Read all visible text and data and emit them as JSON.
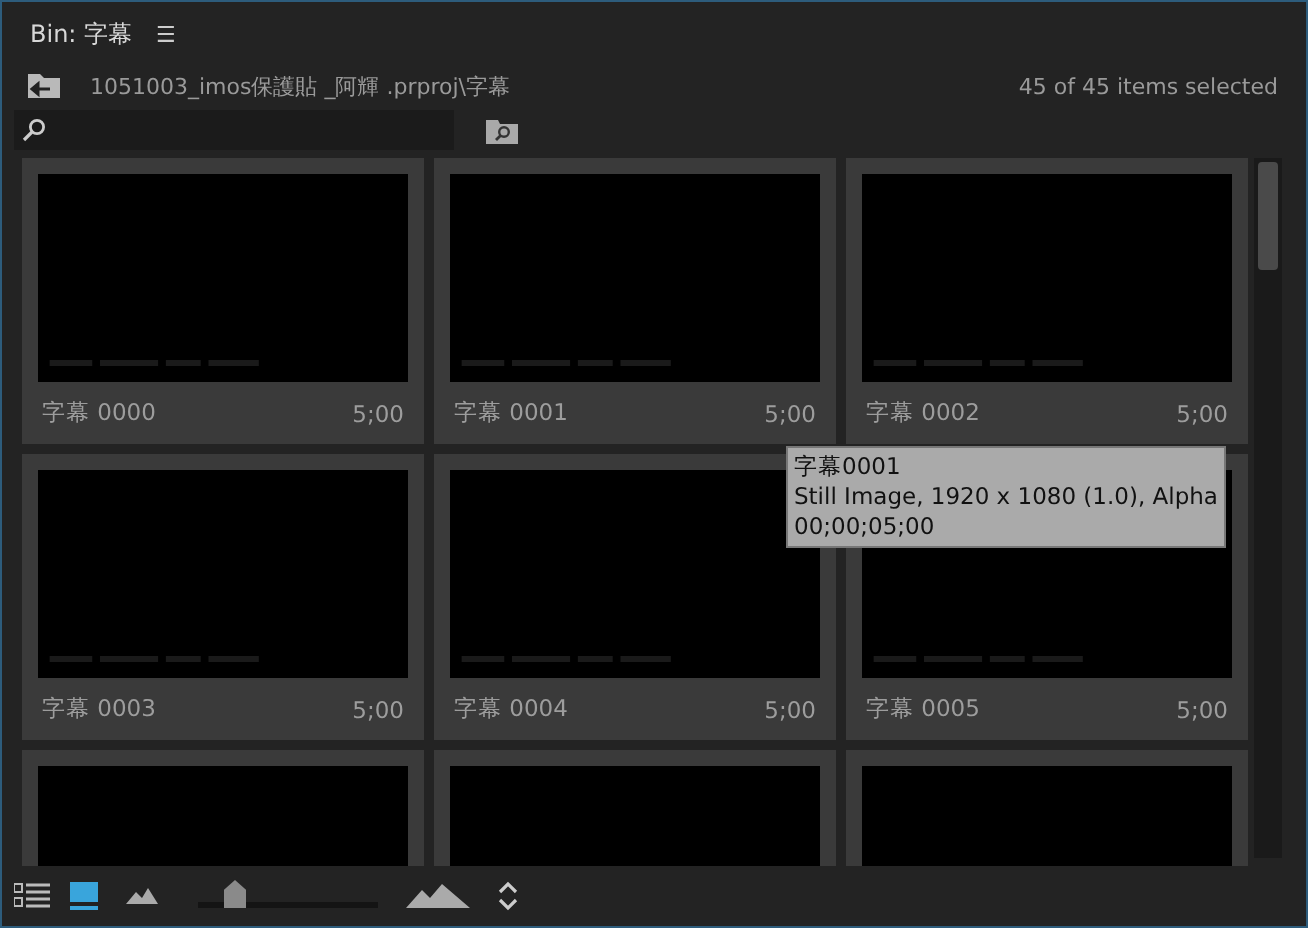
{
  "panel": {
    "title": "Bin: 字幕",
    "menu_glyph": "☰"
  },
  "path": "1051003_imos保護貼 _阿輝 .prproj\\字幕",
  "selection_count": "45 of 45 items selected",
  "items": [
    {
      "name": "字幕 0000",
      "duration": "5;00",
      "selected": true
    },
    {
      "name": "字幕 0001",
      "duration": "5;00",
      "selected": true
    },
    {
      "name": "字幕 0002",
      "duration": "5;00",
      "selected": true
    },
    {
      "name": "字幕 0003",
      "duration": "5;00",
      "selected": true
    },
    {
      "name": "字幕 0004",
      "duration": "5;00",
      "selected": true
    },
    {
      "name": "字幕 0005",
      "duration": "5;00",
      "selected": true
    },
    {
      "selected": true
    },
    {
      "selected": true
    },
    {
      "selected": true
    }
  ],
  "tooltip": {
    "lines": [
      "字幕0001",
      "Still Image, 1920 x 1080 (1.0), Alpha",
      "00;00;05;00"
    ]
  },
  "views": [
    {
      "kind": "list",
      "selected": false
    },
    {
      "kind": "icon",
      "selected": true
    }
  ],
  "zoom_slider": {
    "level": 0.2
  }
}
